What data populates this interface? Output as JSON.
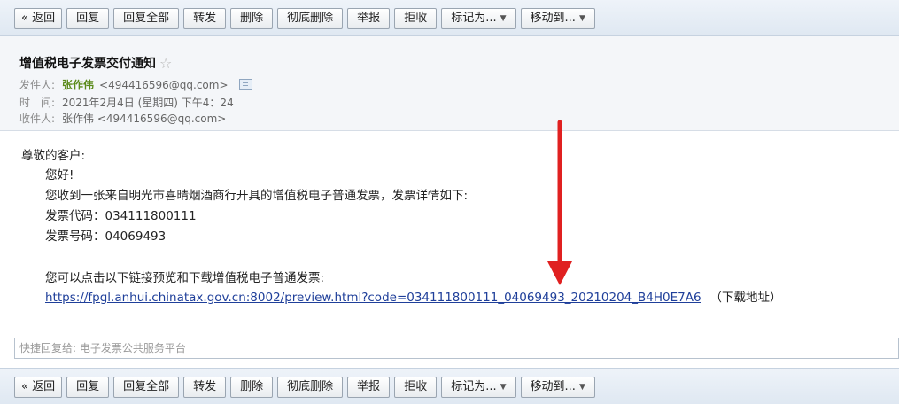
{
  "toolbar": {
    "back": "« 返回",
    "reply": "回复",
    "reply_all": "回复全部",
    "forward": "转发",
    "delete": "删除",
    "delete_forever": "彻底删除",
    "report": "举报",
    "reject": "拒收",
    "mark_as": "标记为...",
    "move_to": "移动到..."
  },
  "email": {
    "subject": "增值税电子发票交付通知",
    "sender_label": "发件人:",
    "sender_name": "张作伟",
    "sender_email": "<494416596@qq.com>",
    "time_label": "时　间:",
    "time_value": "2021年2月4日 (星期四) 下午4：24",
    "recipient_label": "收件人:",
    "recipient_value": "张作伟 <494416596@qq.com>"
  },
  "body": {
    "greeting": "尊敬的客户:",
    "hello": "您好!",
    "line1": "您收到一张来自明光市喜晴烟酒商行开具的增值税电子普通发票，发票详情如下:",
    "invoice_code": "发票代码：034111800111",
    "invoice_number": "发票号码：04069493",
    "line2": "您可以点击以下链接预览和下载增值税电子普通发票:",
    "link": "https://fpgl.anhui.chinatax.gov.cn:8002/preview.html?code=034111800111_04069493_20210204_B4H0E7A6",
    "link_note": "（下载地址）"
  },
  "quick_reply": {
    "placeholder": "快捷回复给: 电子发票公共服务平台"
  },
  "annotation": {
    "arrow_color": "#e02020"
  }
}
